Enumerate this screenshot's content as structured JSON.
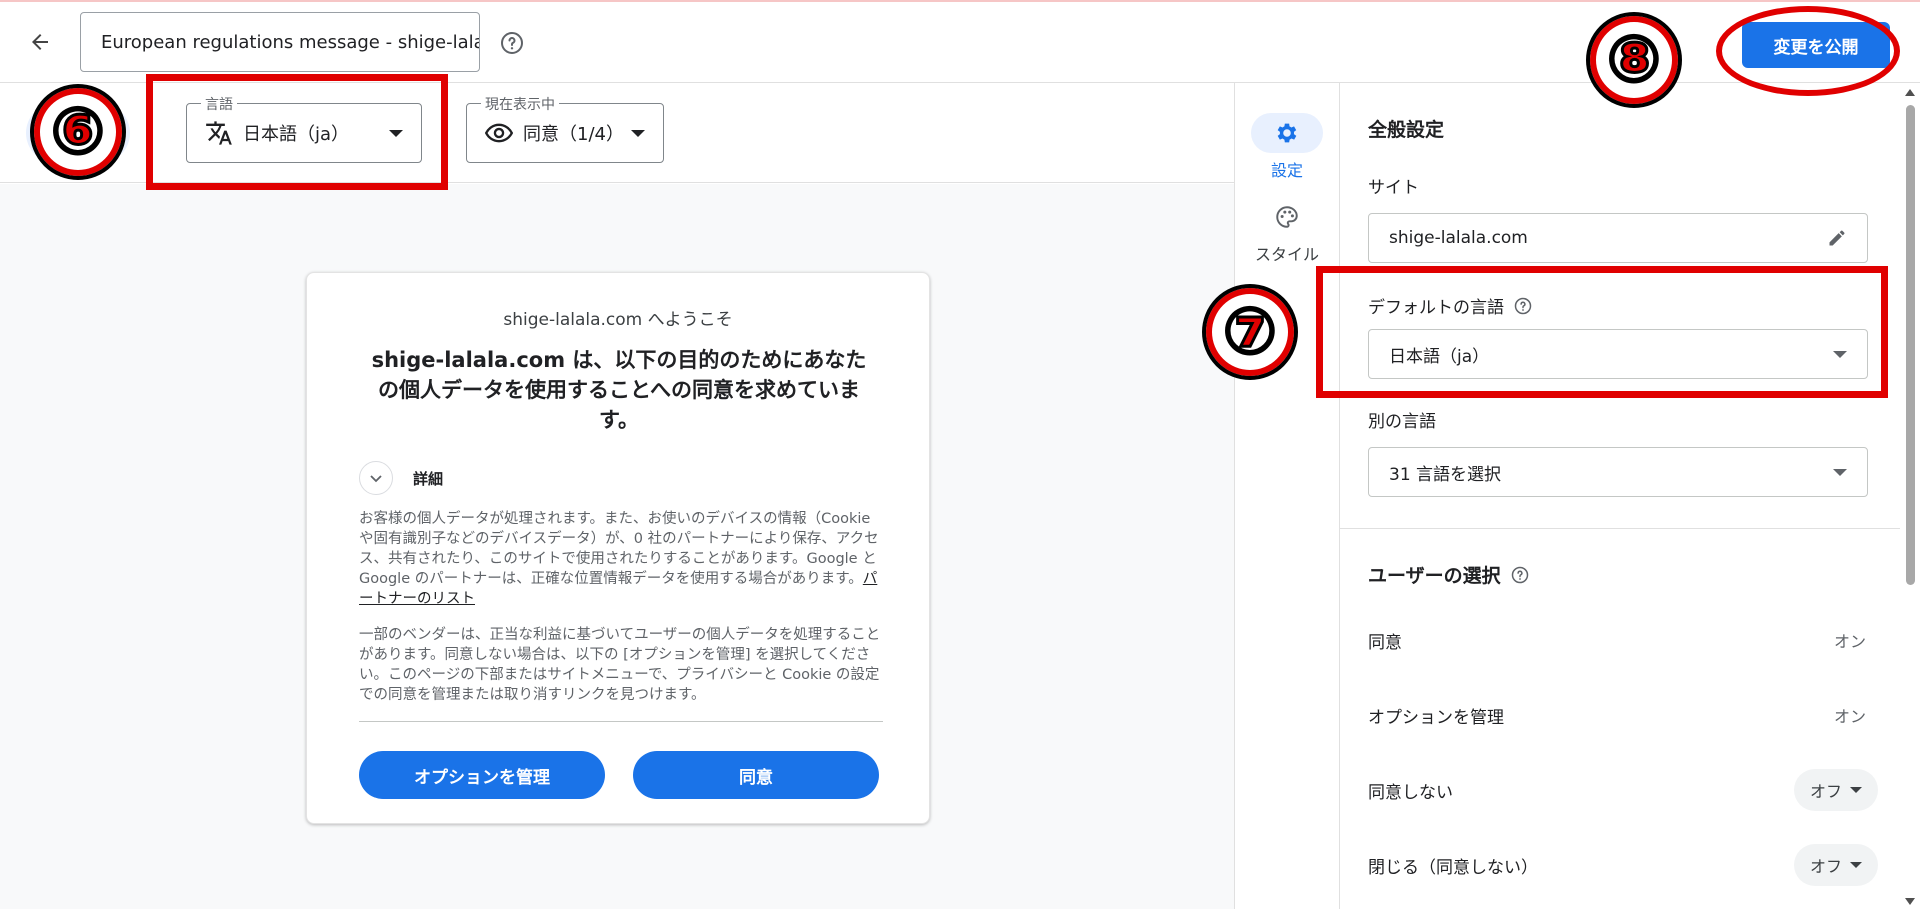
{
  "header": {
    "back_label": "←",
    "title_value": "European regulations message - shige-lalala.com",
    "publish_label": "変更を公開"
  },
  "toolbar": {
    "language": {
      "label": "言語",
      "value": "日本語（ja）"
    },
    "view": {
      "label": "現在表示中",
      "value": "同意（1/4）"
    }
  },
  "dialog": {
    "welcome": "shige-lalala.com へようこそ",
    "headline": "shige-lalala.com は、以下の目的のためにあなたの個人データを使用することへの同意を求めています。",
    "details_label": "詳細",
    "para1_text": "お客様の個人データが処理されます。また、お使いのデバイスの情報（Cookie や固有識別子などのデバイスデータ）が、0 社のパートナーにより保存、アクセス、共有されたり、このサイトで使用されたりすることがあります。Google と Google のパートナーは、正確な位置情報データを使用する場合があります。",
    "para1_link": "パートナーのリスト",
    "para2_text": "一部のベンダーは、正当な利益に基づいてユーザーの個人データを処理することがあります。同意しない場合は、以下の [オプションを管理] を選択してください。このページの下部またはサイトメニューで、プライバシーと Cookie の設定での同意を管理または取り消すリンクを見つけます。",
    "manage_button": "オプションを管理",
    "consent_button": "同意"
  },
  "rail": {
    "settings_label": "設定",
    "style_label": "スタイル"
  },
  "panel": {
    "general_title": "全般設定",
    "site_label": "サイト",
    "site_value": "shige-lalala.com",
    "default_lang_label": "デフォルトの言語",
    "default_lang_value": "日本語（ja）",
    "other_lang_label": "別の言語",
    "other_lang_value": "31 言語を選択",
    "user_choice_title": "ユーザーの選択",
    "options": [
      {
        "label": "同意",
        "value": "オン"
      },
      {
        "label": "オプションを管理",
        "value": "オン"
      },
      {
        "label": "同意しない",
        "value": "オフ"
      },
      {
        "label": "閉じる（同意しない）",
        "value": "オフ"
      }
    ]
  },
  "annotations": {
    "six": "⑥",
    "seven": "⑦",
    "eight": "⑧"
  },
  "colors": {
    "accent": "#1a73e8",
    "annotation_red": "#e00000"
  }
}
